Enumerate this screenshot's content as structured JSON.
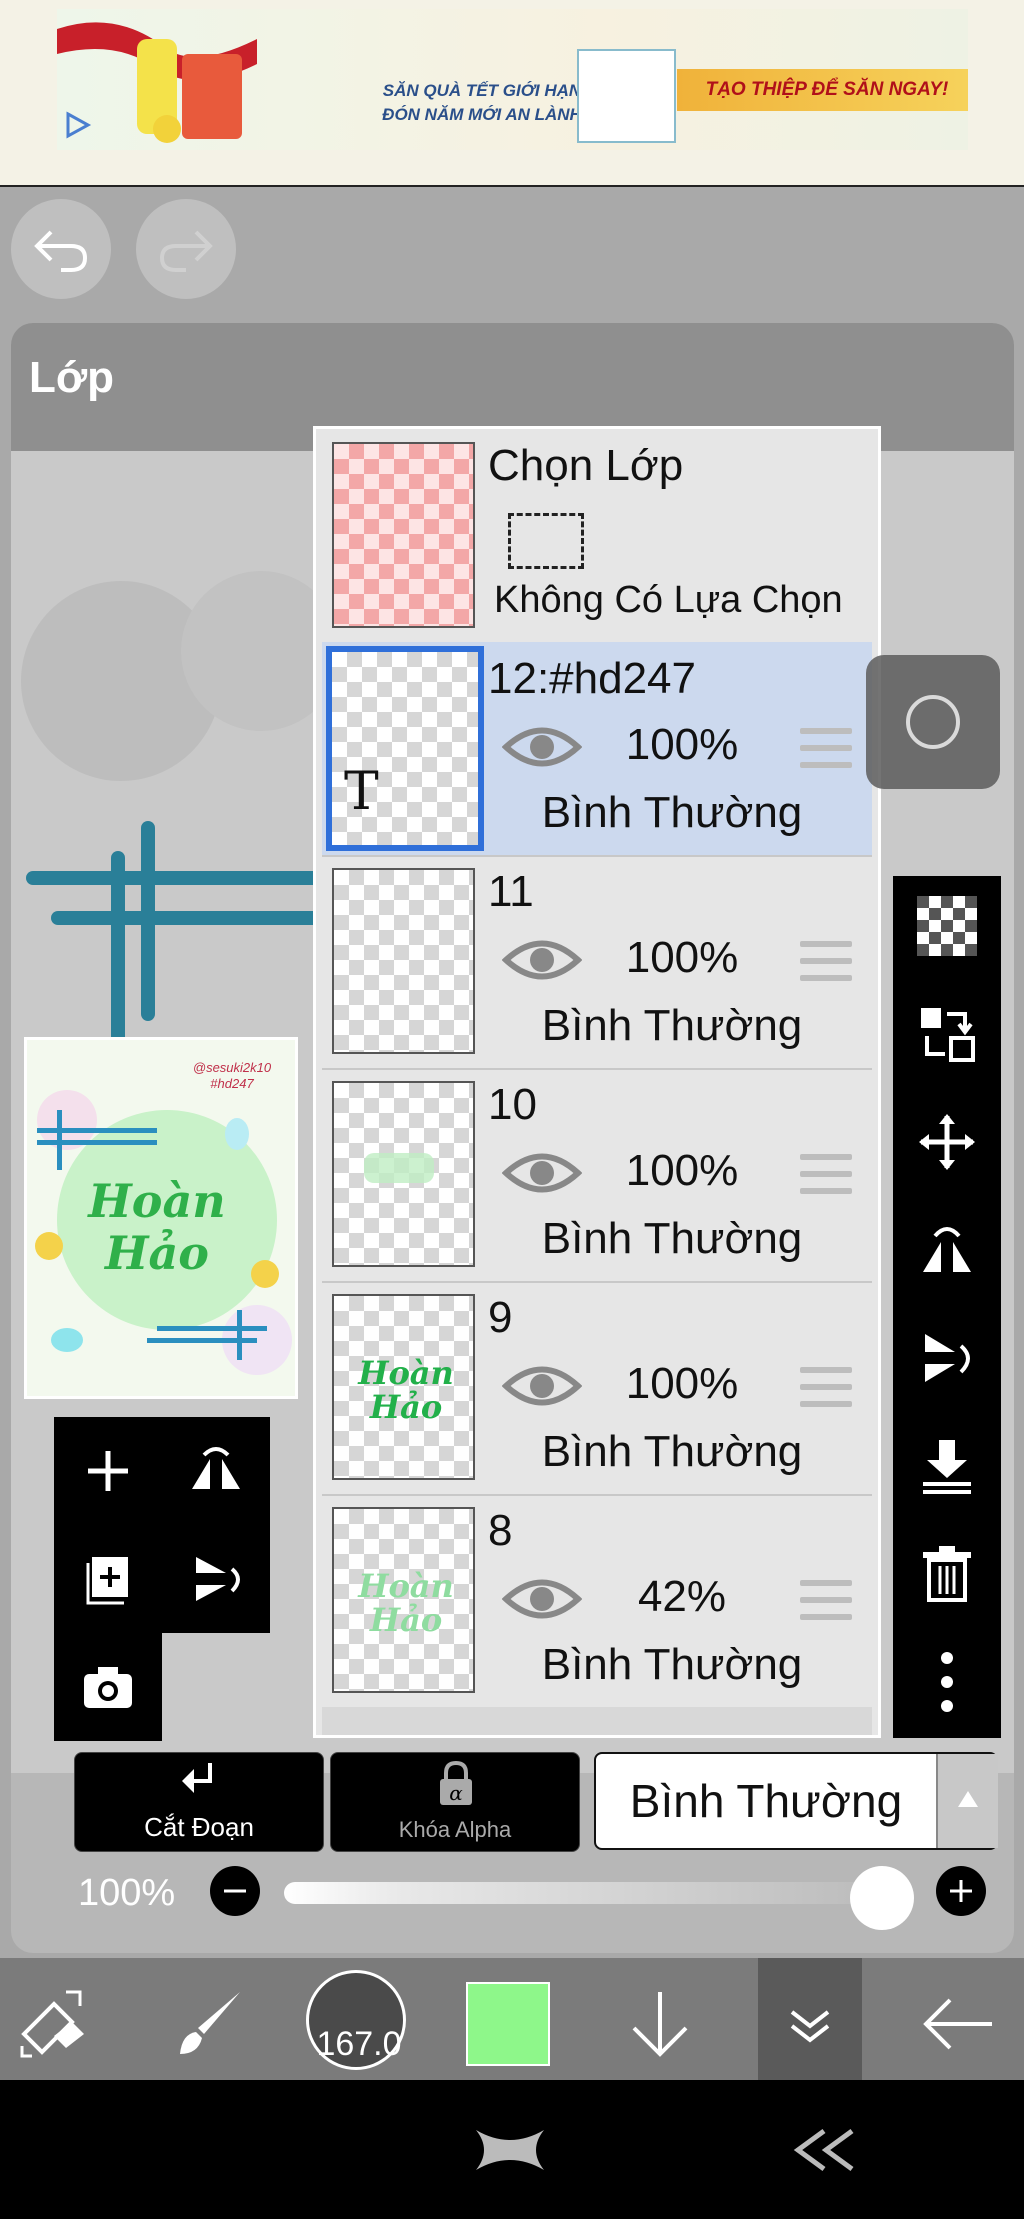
{
  "ad": {
    "left_text_line1": "SĂN QUÀ TẾT GIỚI HẠN",
    "left_text_line2": "ĐÓN NĂM MỚI AN LÀNH",
    "cta": "TẠO THIỆP ĐỂ SĂN NGAY!"
  },
  "panel": {
    "title": "Lớp"
  },
  "thumbnail": {
    "handle_line1": "@sesuki2k10",
    "handle_line2": "#hd247",
    "word1": "Hoàn",
    "word2": "Hảo"
  },
  "selection": {
    "title": "Chọn Lớp",
    "status": "Không Có Lựa Chọn"
  },
  "layers": [
    {
      "name": "12:#hd247",
      "opacity": "100%",
      "mode": "Bình Thường",
      "selected": true,
      "glyph": "T"
    },
    {
      "name": "11",
      "opacity": "100%",
      "mode": "Bình Thường"
    },
    {
      "name": "10",
      "opacity": "100%",
      "mode": "Bình Thường"
    },
    {
      "name": "9",
      "opacity": "100%",
      "mode": "Bình Thường",
      "thumb_word1": "Hoàn",
      "thumb_word2": "Hảo"
    },
    {
      "name": "8",
      "opacity": "42%",
      "mode": "Bình Thường",
      "thumb_word1": "Hoàn",
      "thumb_word2": "Hảo"
    }
  ],
  "bottom": {
    "clip_label": "Cắt Đoạn",
    "alpha_lock_label": "Khóa Alpha",
    "blend_mode": "Bình Thường",
    "opacity_label": "100%",
    "opacity_value": 1.0
  },
  "toolbar": {
    "brush_size": "167.0",
    "color": "#8ef78a"
  },
  "icons": {
    "right_tools": [
      "checker-icon",
      "transfer-layer-icon",
      "move-icon",
      "flip-horizontal-icon",
      "flip-vertical-icon",
      "merge-down-icon",
      "trash-icon",
      "more-icon"
    ]
  }
}
